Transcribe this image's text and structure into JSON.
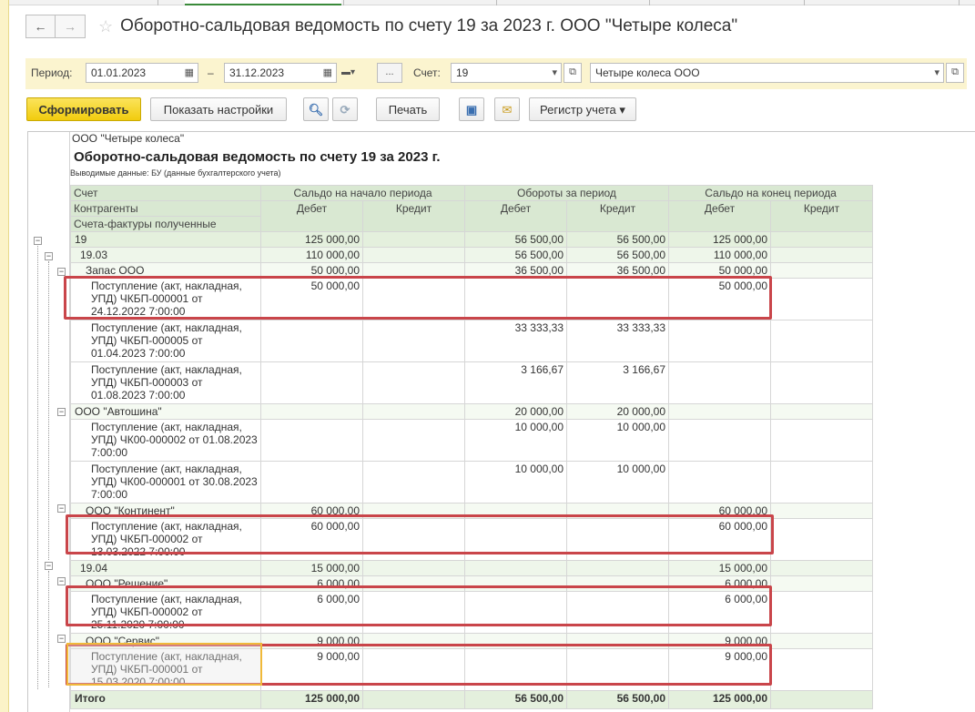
{
  "window": {
    "title": "Оборотно-сальдовая ведомость по счету 19 за 2023 г. ООО \"Четыре колеса\""
  },
  "nav": {
    "back_icon": "←",
    "forward_icon": "→",
    "favorite_icon": "☆"
  },
  "params": {
    "period_label": "Период:",
    "date_from": "01.01.2023",
    "date_sep": "–",
    "date_to": "31.12.2023",
    "ellipsis": "...",
    "account_label": "Счет:",
    "account_value": "19",
    "organization_value": "Четыре колеса ООО"
  },
  "toolbar": {
    "generate": "Сформировать",
    "show_settings": "Показать настройки",
    "print": "Печать",
    "register": "Регистр учета"
  },
  "report": {
    "org": "ООО \"Четыре колеса\"",
    "title": "Оборотно-сальдовая ведомость по счету 19 за 2023 г.",
    "subtitle": "Выводимые данные: БУ (данные бухгалтерского учета)",
    "headers": {
      "account": "Счет",
      "counterparties": "Контрагенты",
      "invoices": "Счета-фактуры полученные",
      "opening": "Сальдо на начало периода",
      "turnover": "Обороты за период",
      "closing": "Сальдо на конец периода",
      "debit": "Дебет",
      "credit": "Кредит"
    },
    "rows": [
      {
        "name": "19",
        "ob_d": "125 000,00",
        "ob_c": "",
        "t_d": "56 500,00",
        "t_c": "56 500,00",
        "cb_d": "125 000,00",
        "cb_c": ""
      },
      {
        "name": "19.03",
        "ob_d": "110 000,00",
        "ob_c": "",
        "t_d": "56 500,00",
        "t_c": "56 500,00",
        "cb_d": "110 000,00",
        "cb_c": ""
      },
      {
        "name": "Запас ООО",
        "ob_d": "50 000,00",
        "ob_c": "",
        "t_d": "36 500,00",
        "t_c": "36 500,00",
        "cb_d": "50 000,00",
        "cb_c": ""
      },
      {
        "name": "Поступление (акт, накладная, УПД) ЧКБП-000001 от 24.12.2022 7:00:00",
        "ob_d": "50 000,00",
        "ob_c": "",
        "t_d": "",
        "t_c": "",
        "cb_d": "50 000,00",
        "cb_c": ""
      },
      {
        "name": "Поступление (акт, накладная, УПД) ЧКБП-000005 от 01.04.2023 7:00:00",
        "ob_d": "",
        "ob_c": "",
        "t_d": "33 333,33",
        "t_c": "33 333,33",
        "cb_d": "",
        "cb_c": ""
      },
      {
        "name": "Поступление (акт, накладная, УПД) ЧКБП-000003 от 01.08.2023 7:00:00",
        "ob_d": "",
        "ob_c": "",
        "t_d": "3 166,67",
        "t_c": "3 166,67",
        "cb_d": "",
        "cb_c": ""
      },
      {
        "name": "ООО \"Автошина\"",
        "ob_d": "",
        "ob_c": "",
        "t_d": "20 000,00",
        "t_c": "20 000,00",
        "cb_d": "",
        "cb_c": ""
      },
      {
        "name": "Поступление (акт, накладная, УПД) ЧК00-000002 от 01.08.2023 7:00:00",
        "ob_d": "",
        "ob_c": "",
        "t_d": "10 000,00",
        "t_c": "10 000,00",
        "cb_d": "",
        "cb_c": ""
      },
      {
        "name": "Поступление (акт, накладная, УПД) ЧК00-000001 от 30.08.2023 7:00:00",
        "ob_d": "",
        "ob_c": "",
        "t_d": "10 000,00",
        "t_c": "10 000,00",
        "cb_d": "",
        "cb_c": ""
      },
      {
        "name": "ООО \"Континент\"",
        "ob_d": "60 000,00",
        "ob_c": "",
        "t_d": "",
        "t_c": "",
        "cb_d": "60 000,00",
        "cb_c": ""
      },
      {
        "name": "Поступление (акт, накладная, УПД) ЧКБП-000002 от 13.03.2022 7:00:00",
        "ob_d": "60 000,00",
        "ob_c": "",
        "t_d": "",
        "t_c": "",
        "cb_d": "60 000,00",
        "cb_c": ""
      },
      {
        "name": "19.04",
        "ob_d": "15 000,00",
        "ob_c": "",
        "t_d": "",
        "t_c": "",
        "cb_d": "15 000,00",
        "cb_c": ""
      },
      {
        "name": "ООО \"Решение\"",
        "ob_d": "6 000,00",
        "ob_c": "",
        "t_d": "",
        "t_c": "",
        "cb_d": "6 000,00",
        "cb_c": ""
      },
      {
        "name": "Поступление (акт, накладная, УПД) ЧКБП-000002 от 25.11.2020 7:00:00",
        "ob_d": "6 000,00",
        "ob_c": "",
        "t_d": "",
        "t_c": "",
        "cb_d": "6 000,00",
        "cb_c": ""
      },
      {
        "name": "ООО \"Сервис\"",
        "ob_d": "9 000,00",
        "ob_c": "",
        "t_d": "",
        "t_c": "",
        "cb_d": "9 000,00",
        "cb_c": ""
      },
      {
        "name": "Поступление (акт, накладная, УПД) ЧКБП-000001 от 15.03.2020 7:00:00",
        "ob_d": "9 000,00",
        "ob_c": "",
        "t_d": "",
        "t_c": "",
        "cb_d": "9 000,00",
        "cb_c": ""
      }
    ],
    "total": {
      "name": "Итого",
      "ob_d": "125 000,00",
      "ob_c": "",
      "t_d": "56 500,00",
      "t_c": "56 500,00",
      "cb_d": "125 000,00",
      "cb_c": ""
    }
  },
  "colors": {
    "header_green": "#d9e8d2",
    "highlight_red": "#c9454a",
    "primary_yellow": "#f1cc0e"
  }
}
